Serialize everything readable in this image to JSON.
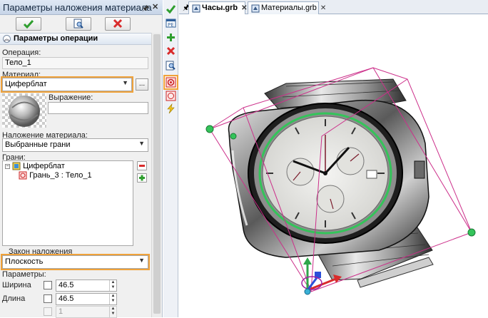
{
  "panel": {
    "title": "Параметры наложения материала",
    "section_title": "Параметры операции",
    "operation_label": "Операция:",
    "operation_value": "Тело_1",
    "material_label": "Материал:",
    "material_value": "Циферблат",
    "browse_label": "...",
    "expression_label": "Выражение:",
    "expression_value": "",
    "mapping_label": "Наложение материала:",
    "mapping_value": "Выбранные грани",
    "faces_label": "Грани:",
    "faces_tree": [
      {
        "label": "Циферблат",
        "icon": "material-node-icon"
      },
      {
        "label": "Грань_3 : Тело_1",
        "icon": "face-icon"
      }
    ],
    "law_label": "Закон наложения",
    "law_value": "Плоскость",
    "params_label": "Параметры:",
    "width_label": "Ширина",
    "width_value": "46.5",
    "length_label": "Длина",
    "length_value": "46.5",
    "third_value": "1"
  },
  "tabs": [
    {
      "label": "Часы.grb",
      "active": true
    },
    {
      "label": "Материалы.grb",
      "active": false
    }
  ],
  "icons": {
    "ok": "checkmark-icon",
    "preview": "preview-icon",
    "cancel": "close-icon",
    "vertical_toolbar": [
      "checkmark-icon",
      "parameters-icon",
      "plus-icon",
      "close-icon",
      "preview-icon",
      "material-icon",
      "material-alt-icon",
      "lightning-icon"
    ]
  },
  "colors": {
    "accent_highlight": "#f0a23a",
    "ok_green": "#2e9e2e",
    "cancel_red": "#d92b2b",
    "bounding_box": "#cc2f8a",
    "handle_green": "#34c45a"
  }
}
